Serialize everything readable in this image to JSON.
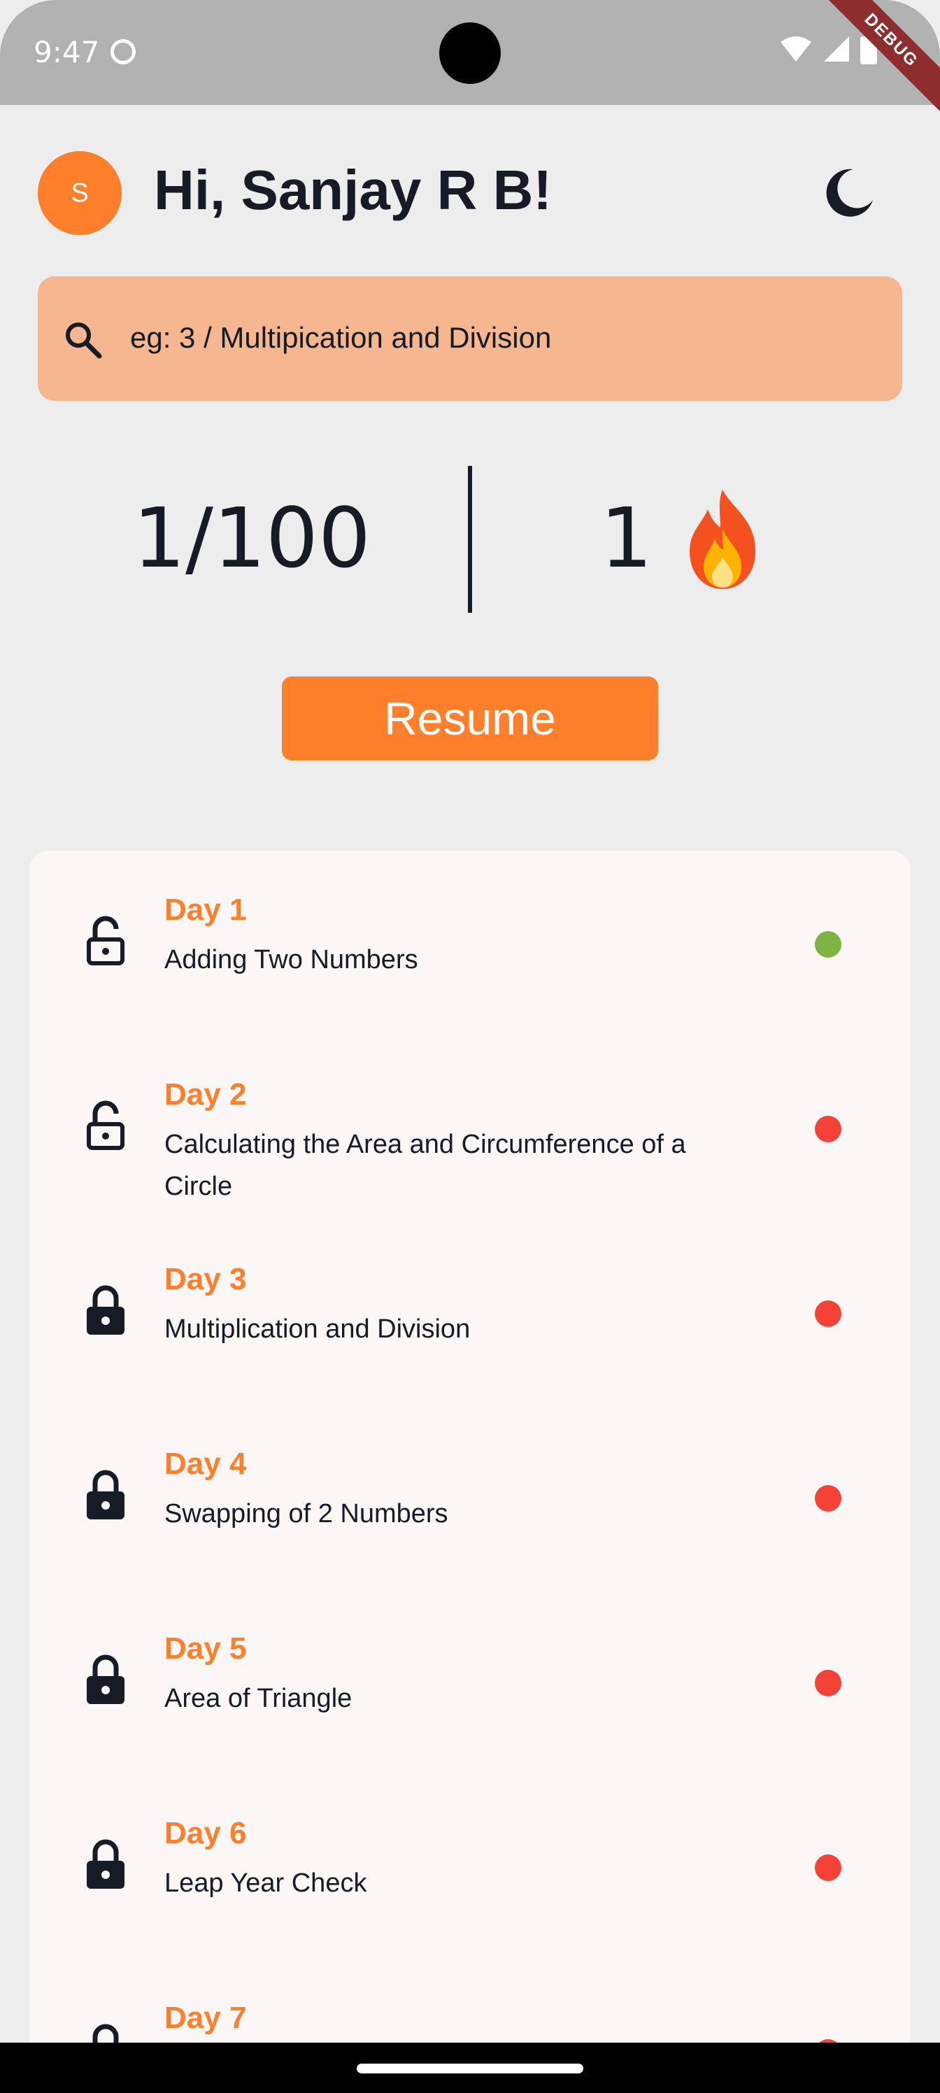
{
  "status_bar": {
    "time": "9:47",
    "debug_label": "DEBUG"
  },
  "header": {
    "avatar_initial": "S",
    "greeting": "Hi, Sanjay R B!",
    "theme_icon": "moon-icon"
  },
  "search": {
    "placeholder": "eg: 3 / Multipication and Division",
    "icon": "search-icon"
  },
  "stats": {
    "progress": "1/100",
    "streak": "1",
    "streak_icon": "fire-icon"
  },
  "resume": {
    "label": "Resume"
  },
  "days": [
    {
      "title": "Day 1",
      "subtitle": "Adding Two Numbers",
      "locked": false,
      "status_color": "#7cb342"
    },
    {
      "title": "Day 2",
      "subtitle": "Calculating the Area and Circumference of a Circle",
      "locked": false,
      "status_color": "#f44336"
    },
    {
      "title": "Day 3",
      "subtitle": "Multiplication and Division",
      "locked": true,
      "status_color": "#f44336"
    },
    {
      "title": "Day 4",
      "subtitle": "Swapping of 2 Numbers",
      "locked": true,
      "status_color": "#f44336"
    },
    {
      "title": "Day 5",
      "subtitle": "Area of Triangle",
      "locked": true,
      "status_color": "#f44336"
    },
    {
      "title": "Day 6",
      "subtitle": "Leap Year Check",
      "locked": true,
      "status_color": "#f44336"
    },
    {
      "title": "Day 7",
      "subtitle": "",
      "locked": true,
      "status_color": "#f44336"
    }
  ],
  "colors": {
    "accent": "#ff7f2a",
    "search_bg": "#f6b68f",
    "completed": "#7cb342",
    "pending": "#f44336",
    "text": "#161b26"
  }
}
